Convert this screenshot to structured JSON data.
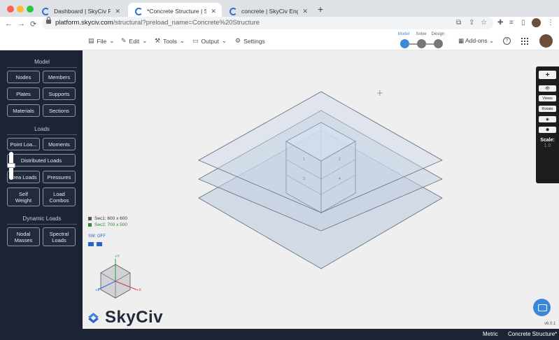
{
  "browser": {
    "tabs": [
      {
        "title": "Dashboard | SkyCiv Platform"
      },
      {
        "title": "*Concrete Structure | SkyCiv"
      },
      {
        "title": "concrete | SkyCiv Engineering"
      }
    ],
    "url_host": "platform.skyciv.com",
    "url_path": "/structural?preload_name=Concrete%20Structure"
  },
  "header": {
    "menus": [
      "File",
      "Edit",
      "Tools",
      "Output",
      "Settings"
    ],
    "steps": [
      "Model",
      "Solve",
      "Design"
    ],
    "addons": "Add-ons",
    "help": "?"
  },
  "sidebar": {
    "model_title": "Model",
    "model_buttons": [
      "Nodes",
      "Members",
      "Plates",
      "Supports",
      "Materials",
      "Sections"
    ],
    "loads_title": "Loads",
    "loads_buttons": [
      "Point Loa...",
      "Moments",
      "Distributed Loads",
      "Area Loads",
      "Pressures",
      "Self\nWeight",
      "Load\nCombos"
    ],
    "dynamic_title": "Dynamic Loads",
    "dynamic_buttons": [
      "Nodal\nMasses",
      "Spectral\nLoads"
    ]
  },
  "viewport": {
    "legend": [
      {
        "label": "Sec1: 600 x 600",
        "color": "#555555"
      },
      {
        "label": "Sec2: 700 x 500",
        "color": "#2e8b2e"
      }
    ],
    "sw_status": "SW: OFF",
    "axis_labels": {
      "y": "+Y",
      "x": "+X",
      "z": "+Z"
    },
    "logo_text": "SkyCiv",
    "version": "v6.0.1",
    "node_labels": [
      "1",
      "2",
      "3",
      "4"
    ]
  },
  "tools": {
    "plus": "+",
    "views": "Views",
    "rotate": "Rotate",
    "scale_label": "Scale:",
    "scale_value": "1.0"
  },
  "status": {
    "units": "Metric",
    "document": "Concrete Structure*"
  }
}
